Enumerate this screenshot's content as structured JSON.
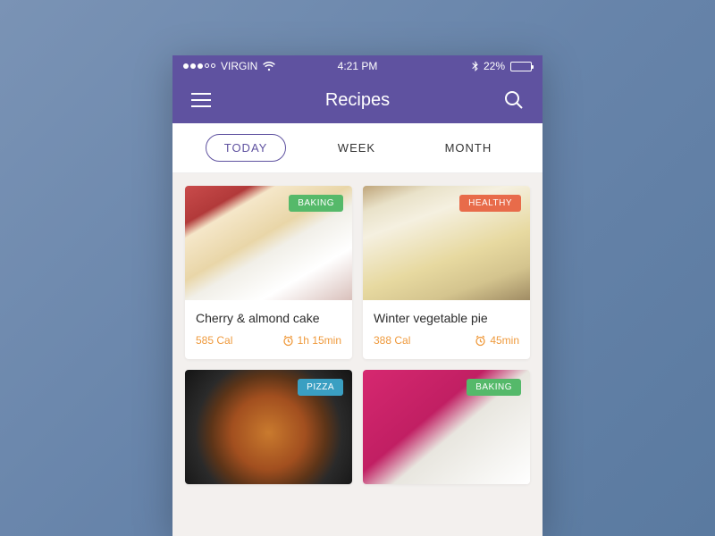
{
  "status": {
    "carrier": "VIRGIN",
    "time": "4:21 PM",
    "battery_pct": "22%"
  },
  "nav": {
    "title": "Recipes"
  },
  "tabs": [
    {
      "label": "TODAY",
      "active": true
    },
    {
      "label": "WEEK",
      "active": false
    },
    {
      "label": "MONTH",
      "active": false
    }
  ],
  "badge_colors": {
    "BAKING": "b-green",
    "HEALTHY": "b-orange",
    "PIZZA": "b-blue"
  },
  "recipes": [
    {
      "title": "Cherry & almond cake",
      "calories": "585 Cal",
      "time": "1h 15min",
      "badge": "BAKING"
    },
    {
      "title": "Winter vegetable pie",
      "calories": "388 Cal",
      "time": "45min",
      "badge": "HEALTHY"
    },
    {
      "title": "",
      "calories": "",
      "time": "",
      "badge": "PIZZA"
    },
    {
      "title": "",
      "calories": "",
      "time": "",
      "badge": "BAKING"
    }
  ]
}
